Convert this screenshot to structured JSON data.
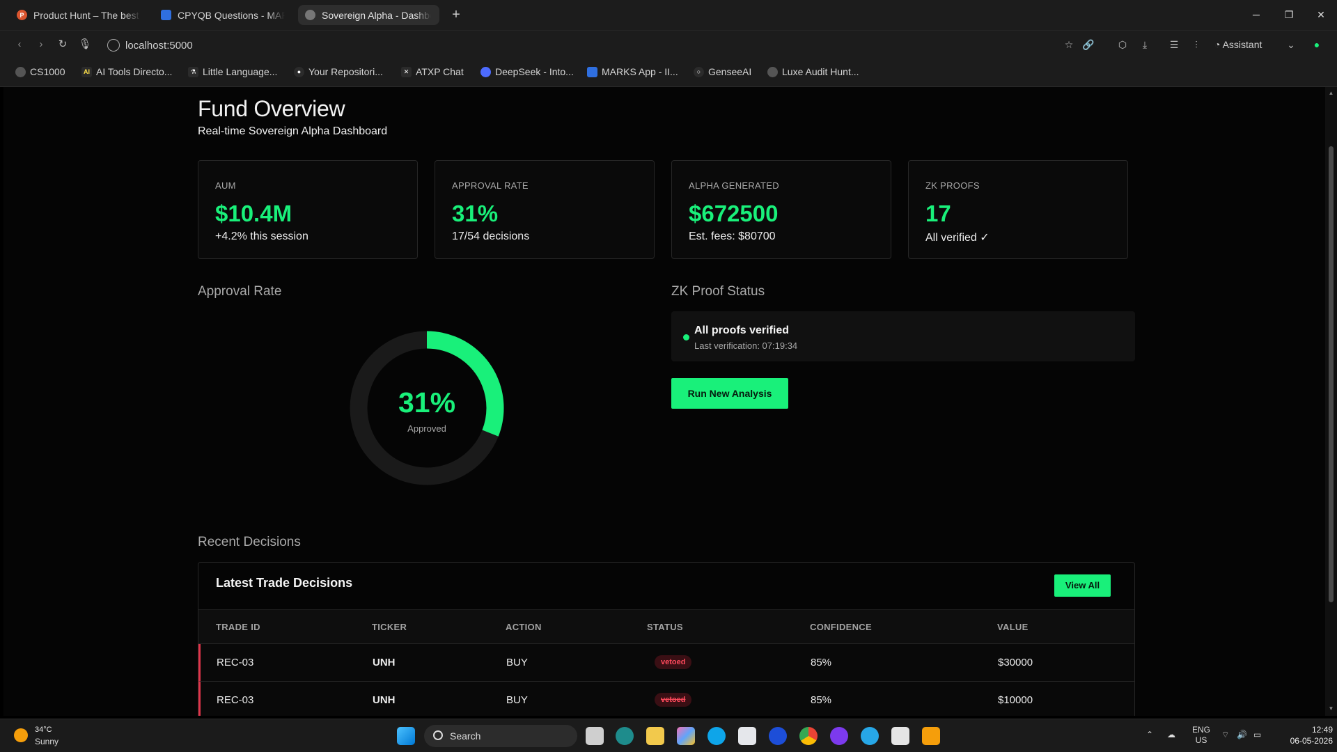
{
  "browser": {
    "tabs": [
      {
        "title": "Product Hunt – The best n",
        "color": "#da552f",
        "glyph": "P"
      },
      {
        "title": "CPYQB Questions - MARK",
        "color": "#2f6fe0",
        "glyph": ""
      },
      {
        "title": "Sovereign Alpha - Dashbo",
        "color": "#777777",
        "glyph": ""
      }
    ],
    "url": "localhost:5000",
    "assistant_label": "Assistant",
    "bookmarks": [
      {
        "label": "CS1000",
        "color": "#555555",
        "glyph": ""
      },
      {
        "label": "AI Tools Directo...",
        "color": "#2b2b2b",
        "glyph": "AI"
      },
      {
        "label": "Little Language...",
        "color": "#2b2b2b",
        "glyph": "⚗"
      },
      {
        "label": "Your Repositori...",
        "color": "#2b2b2b",
        "glyph": "●"
      },
      {
        "label": "ATXP Chat",
        "color": "#2b2b2b",
        "glyph": "✕"
      },
      {
        "label": "DeepSeek - Into...",
        "color": "#4d6bfe",
        "glyph": ""
      },
      {
        "label": "MARKS App - II...",
        "color": "#2f6fe0",
        "glyph": ""
      },
      {
        "label": "GenseeAI",
        "color": "#2b2b2b",
        "glyph": "○"
      },
      {
        "label": "Luxe Audit Hunt...",
        "color": "#555555",
        "glyph": ""
      }
    ]
  },
  "page": {
    "title": "Fund Overview",
    "subtitle": "Real-time Sovereign Alpha Dashboard",
    "cards": [
      {
        "label": "AUM",
        "value": "$10.4M",
        "sub": "+4.2% this session"
      },
      {
        "label": "APPROVAL RATE",
        "value": "31%",
        "sub": "17/54 decisions"
      },
      {
        "label": "ALPHA GENERATED",
        "value": "$672500",
        "sub": "Est. fees: $80700"
      },
      {
        "label": "ZK PROOFS",
        "value": "17",
        "sub": "All verified ✓"
      }
    ],
    "approval_section": "Approval Rate",
    "gauge": {
      "percent": 31,
      "text": "31%",
      "label": "Approved",
      "color": "#19f07a"
    },
    "zk_section": "ZK Proof Status",
    "zk_status": {
      "title": "All proofs verified",
      "sub": "Last verification: 07:19:34"
    },
    "run_button": "Run New Analysis",
    "recent_section": "Recent Decisions",
    "table": {
      "title": "Latest Trade Decisions",
      "view_all": "View All",
      "columns": [
        "TRADE ID",
        "TICKER",
        "ACTION",
        "STATUS",
        "CONFIDENCE",
        "VALUE"
      ],
      "rows": [
        {
          "id": "REC-03",
          "ticker": "UNH",
          "action": "BUY",
          "status": "vetoed",
          "confidence": "85%",
          "value": "$30000"
        },
        {
          "id": "REC-03",
          "ticker": "UNH",
          "action": "BUY",
          "status": "vetoed",
          "confidence": "85%",
          "value": "$10000"
        }
      ]
    }
  },
  "taskbar": {
    "temp": "34°C",
    "condition": "Sunny",
    "search": "Search",
    "lang_top": "ENG",
    "lang_bottom": "US",
    "time": "12:49",
    "date": "06-05-2026"
  },
  "colors": {
    "accent": "#19f07a",
    "danger": "#e0344a"
  }
}
